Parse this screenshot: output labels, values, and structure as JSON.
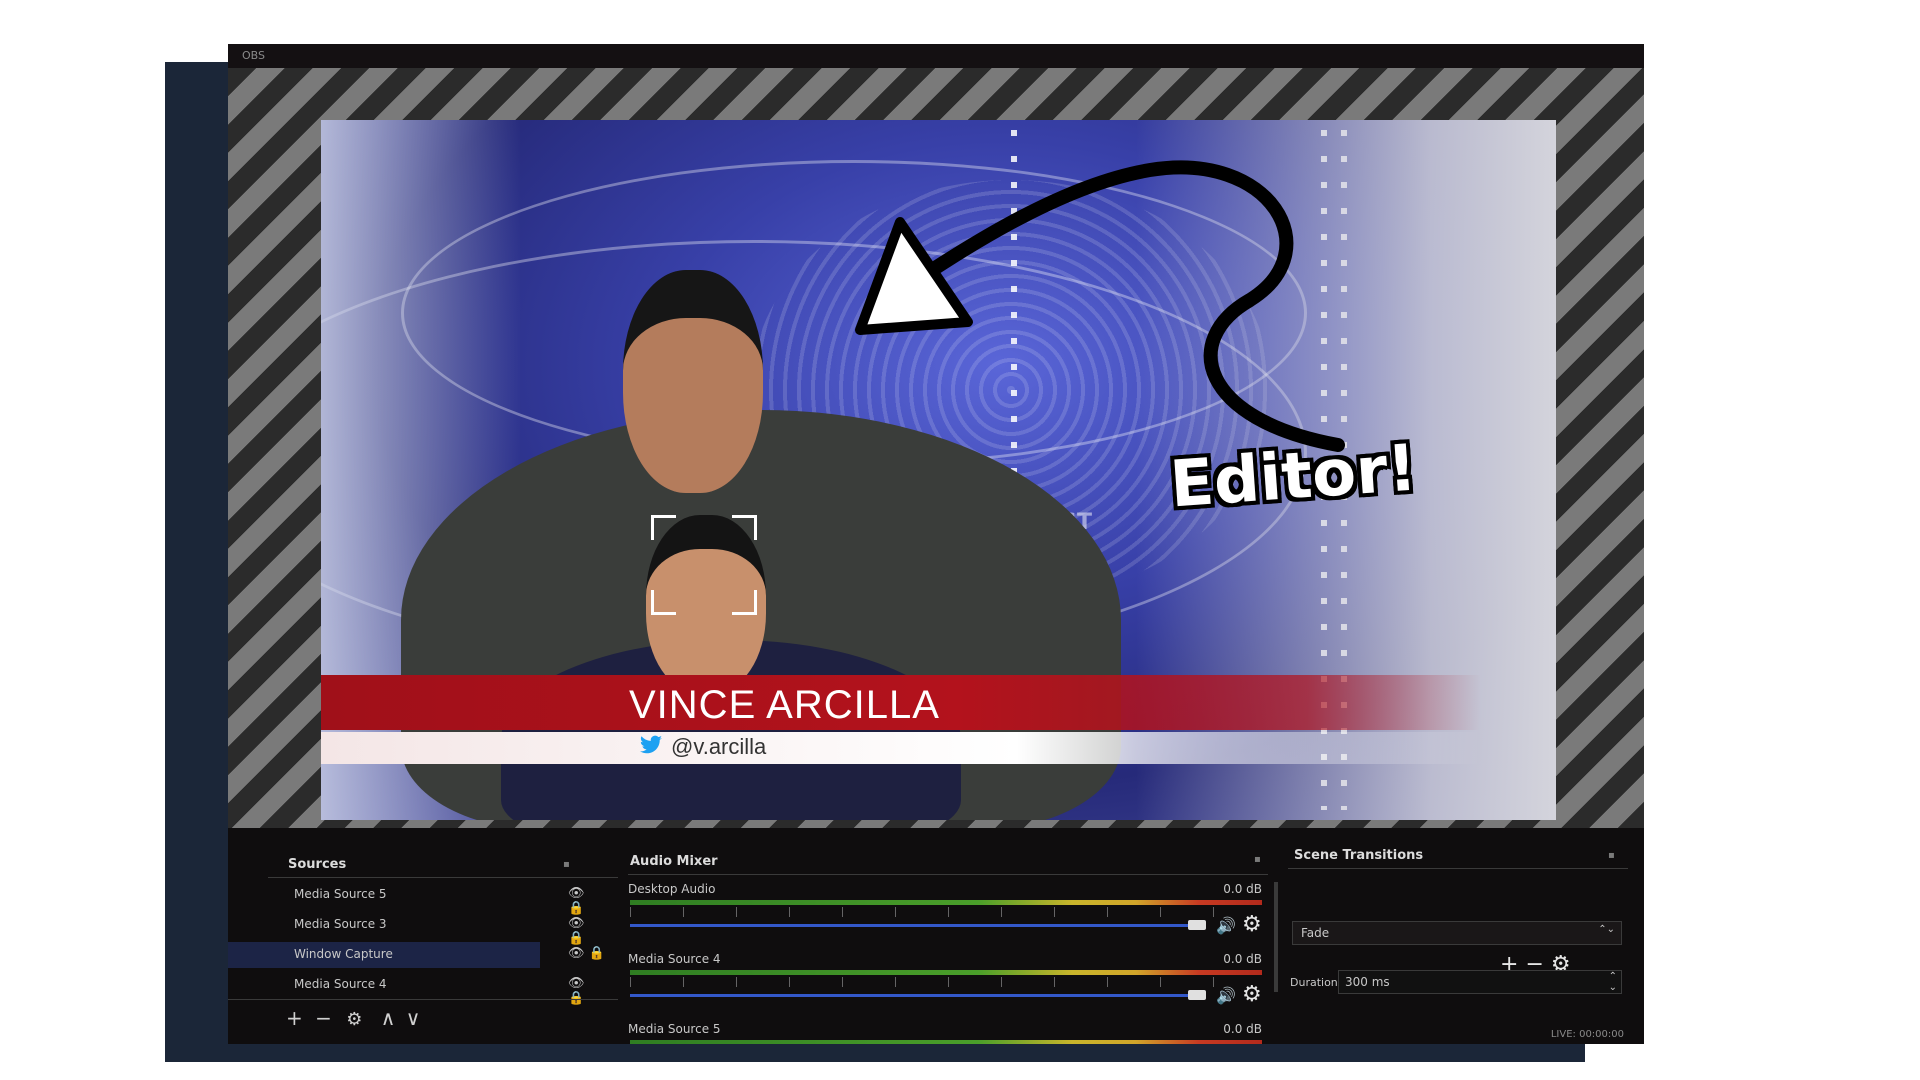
{
  "window": {
    "title": "OBS"
  },
  "preview": {
    "lower_third_name": "VINCE ARCILLA",
    "lower_third_handle": "@v.arcilla",
    "background_text": "FIRST"
  },
  "annotation": {
    "text": "Editor!"
  },
  "sources": {
    "title": "Sources",
    "items": [
      {
        "label": "Media Source 5"
      },
      {
        "label": "Media Source 3"
      },
      {
        "label": "Window Capture",
        "selected": true
      },
      {
        "label": "Media Source 4"
      }
    ],
    "toolbar": {
      "add": "+",
      "remove": "−",
      "settings": "⚙",
      "up": "∧",
      "down": "∨"
    }
  },
  "audio_mixer": {
    "title": "Audio Mixer",
    "channels": [
      {
        "name": "Desktop Audio",
        "db": "0.0 dB"
      },
      {
        "name": "Media Source 4",
        "db": "0.0 dB"
      },
      {
        "name": "Media Source 5",
        "db": "0.0 dB"
      }
    ]
  },
  "scene_transitions": {
    "title": "Scene Transitions",
    "selected": "Fade",
    "duration_label": "Duration",
    "duration_value": "300 ms"
  },
  "status_bar": {
    "text": "LIVE: 00:00:00"
  },
  "colors": {
    "accent_blue": "#3358c9",
    "selection": "#1c2446",
    "lower_third_red": "#b3121c"
  }
}
